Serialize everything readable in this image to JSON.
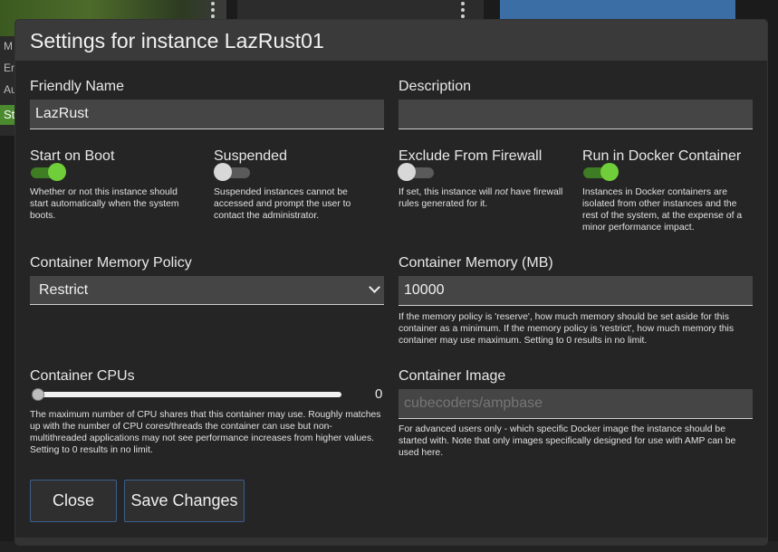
{
  "background": {
    "side_labels": [
      "M",
      "Er",
      "Au"
    ],
    "side_button": "St"
  },
  "modal": {
    "title": "Settings for instance LazRust01",
    "friendly_name": {
      "label": "Friendly Name",
      "value": "LazRust"
    },
    "description": {
      "label": "Description",
      "value": ""
    },
    "start_on_boot": {
      "label": "Start on Boot",
      "on": true,
      "help": "Whether or not this instance should start automatically when the system boots."
    },
    "suspended": {
      "label": "Suspended",
      "on": false,
      "help": "Suspended instances cannot be accessed and prompt the user to contact the administrator."
    },
    "exclude_firewall": {
      "label": "Exclude From Firewall",
      "on": false,
      "help_pre": "If set, this instance will ",
      "help_em": "not",
      "help_post": " have firewall rules generated for it."
    },
    "run_in_docker": {
      "label": "Run in Docker Container",
      "on": true,
      "help": "Instances in Docker containers are isolated from other instances and the rest of the system, at the expense of a minor performance impact."
    },
    "memory_policy": {
      "label": "Container Memory Policy",
      "selected": "Restrict"
    },
    "memory_mb": {
      "label": "Container Memory (MB)",
      "value": "10000",
      "help": "If the memory policy is 'reserve', how much memory should be set aside for this container as a minimum. If the memory policy is 'restrict', how much memory this container may use maximum. Setting to 0 results in no limit."
    },
    "cpus": {
      "label": "Container CPUs",
      "value": "0",
      "help": "The maximum number of CPU shares that this container may use. Roughly matches up with the number of CPU cores/threads the container can use but non-multithreaded applications may not see performance increases from higher values. Setting to 0 results in no limit."
    },
    "image": {
      "label": "Container Image",
      "placeholder": "cubecoders/ampbase",
      "help": "For advanced users only - which specific Docker image the instance should be started with. Note that only images specifically designed for use with AMP can be used here."
    },
    "close_label": "Close",
    "save_label": "Save Changes"
  },
  "colors": {
    "toggle_on": "#6fce3a",
    "button_border": "#3d5f8e",
    "header_bg": "#3a3a3a"
  }
}
